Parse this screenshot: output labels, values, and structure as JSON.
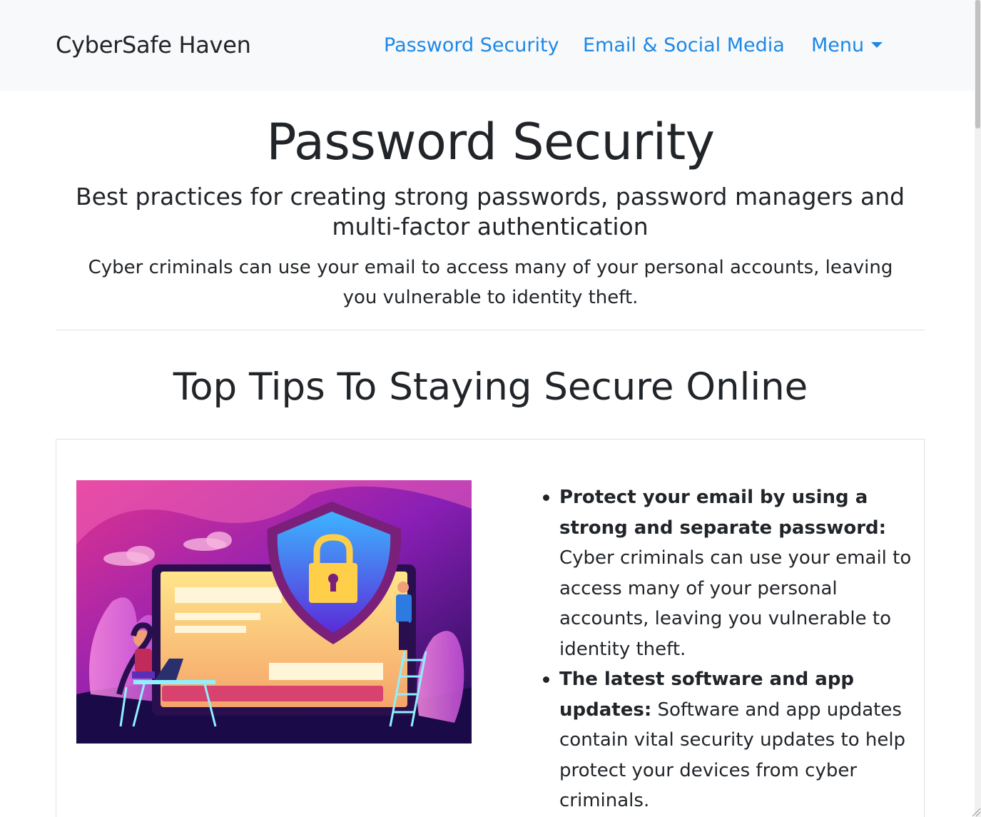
{
  "navbar": {
    "brand": "CyberSafe Haven",
    "links": [
      {
        "label": "Password Security"
      },
      {
        "label": "Email & Social Media"
      }
    ],
    "menu_label": "Menu"
  },
  "hero": {
    "title": "Password Security",
    "subtitle": "Best practices for creating strong passwords, password managers and multi-factor authentication",
    "text": "Cyber criminals can use your email to access many of your personal accounts, leaving you vulnerable to identity theft."
  },
  "section": {
    "title": "Top Tips To Staying Secure Online"
  },
  "tips": [
    {
      "title": "Protect your email by using a strong and separate password:",
      "text": " Cyber criminals can use your email to access many of your personal accounts, leaving you vulnerable to identity theft."
    },
    {
      "title": "The latest software and app updates:",
      "text": " Software and app updates contain vital security updates to help protect your devices from cyber criminals."
    }
  ],
  "illustration": {
    "icon": "shield-lock-illustration"
  },
  "colors": {
    "nav_bg": "#f8f9fa",
    "link": "#1e88e5",
    "text": "#212529"
  }
}
